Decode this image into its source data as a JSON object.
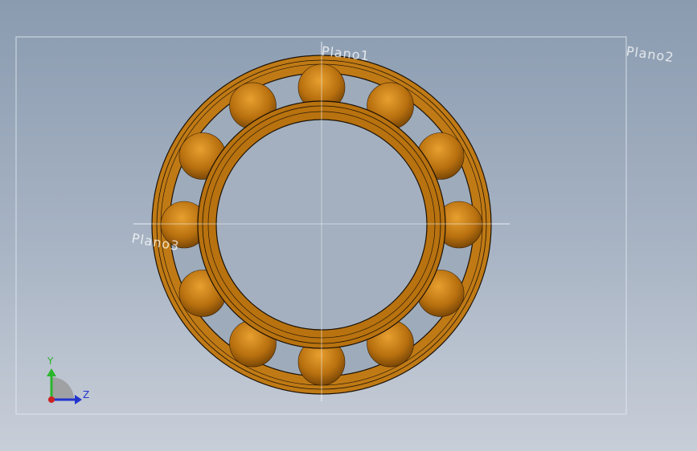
{
  "planes": {
    "plano1": "Plano1",
    "plano2": "Plano2",
    "plano3": "Plano3"
  },
  "triad": {
    "y_label": "Y",
    "z_label": "Z",
    "y_color": "#2bb52b",
    "z_color": "#2233cc",
    "origin_color": "#cc2222"
  },
  "model": {
    "part": "ball-bearing",
    "ball_count": 12,
    "material_color": "#b8720f",
    "edge_color": "#1a1005"
  }
}
